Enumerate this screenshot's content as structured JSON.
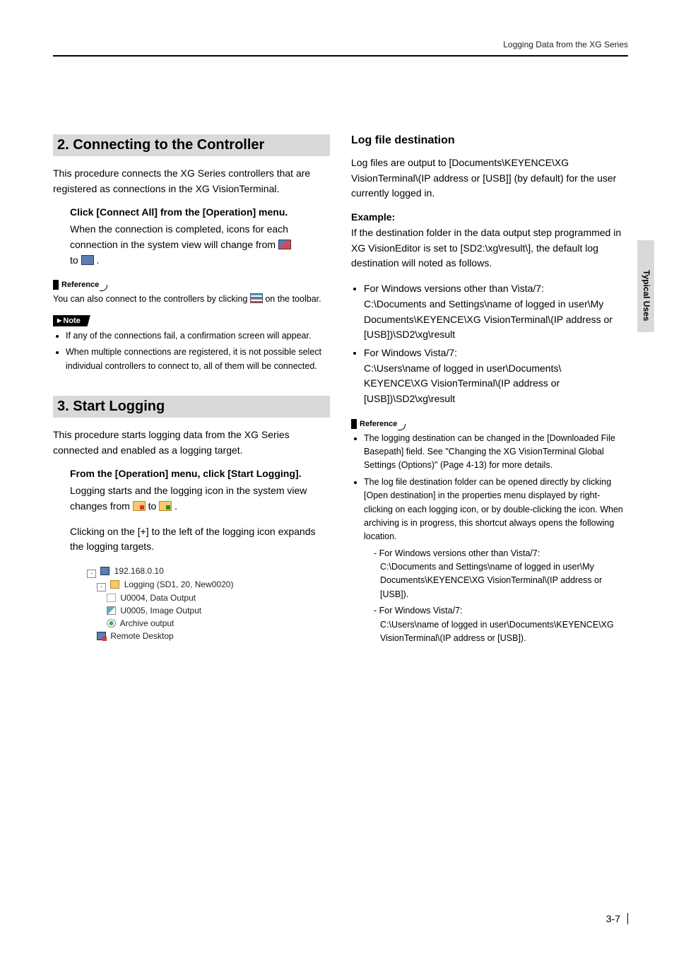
{
  "header": {
    "running": "Logging Data from the XG Series"
  },
  "side": {
    "label": "Typical Uses"
  },
  "page_number": "3-7",
  "sec2": {
    "title": "2. Connecting to the Controller",
    "intro": "This procedure connects the XG Series controllers that are registered as connections in the XG VisionTerminal.",
    "step_bold": "Click [Connect All] from the [Operation] menu.",
    "step_after1": "When the connection is completed, icons for each connection in the system view will change from ",
    "step_after2": "to ",
    "step_after3": " .",
    "ref_label": "Reference",
    "ref_text1": "You can also connect to the controllers by clicking ",
    "ref_text2": " on the toolbar.",
    "note_label": "Note",
    "note_items": [
      "If any of the connections fail, a confirmation screen will appear.",
      "When multiple connections are registered, it is not possible select individual controllers to connect to, all of them will be connected."
    ]
  },
  "sec3": {
    "title": "3. Start Logging",
    "intro": "This procedure starts logging data from the XG Series connected and enabled as a logging target.",
    "step_bold": "From the [Operation] menu, click [Start Logging].",
    "step_after1": "Logging starts and the logging icon in the system view changes from ",
    "step_mid": " to ",
    "step_after2": " .",
    "step_after3": "Clicking on the [+] to the left of the logging icon expands the logging targets.",
    "tree": {
      "root": "192.168.0.10",
      "logging": "Logging (SD1, 20, New0020)",
      "children": [
        "U0004, Data Output",
        "U0005, Image Output",
        "Archive output"
      ],
      "remote": "Remote Desktop"
    }
  },
  "right": {
    "subhead": "Log file destination",
    "intro": "Log files are output to [Documents\\KEYENCE\\XG VisionTerminal\\(IP address or [USB]] (by default) for the user currently logged in.",
    "example_label": "Example:",
    "example_intro": "If the destination folder in the data output step programmed in XG VisionEditor is set to [SD2:\\xg\\result\\], the default log destination will noted as follows.",
    "paths": [
      {
        "label": "For Windows versions other than Vista/7:",
        "path": "C:\\Documents and Settings\\name of logged in user\\My Documents\\KEYENCE\\XG VisionTerminal\\(IP address or [USB])\\SD2\\xg\\result"
      },
      {
        "label": "For Windows Vista/7:",
        "path": "C:\\Users\\name of logged in user\\Documents\\ KEYENCE\\XG VisionTerminal\\(IP address or [USB])\\SD2\\xg\\result"
      }
    ],
    "ref_label": "Reference",
    "ref_items": [
      "The logging destination can be changed in the [Downloaded File Basepath] field. See \"Changing the XG VisionTerminal Global Settings (Options)\" (Page 4-13) for more details.",
      "The log file destination folder can be opened directly by clicking [Open destination] in the properties menu displayed by right-clicking on each logging icon, or by double-clicking the icon. When archiving is in progress, this shortcut always opens the following location."
    ],
    "ref_sub": [
      {
        "label": "For Windows versions other than Vista/7:",
        "path": "C:\\Documents and Settings\\name of logged in user\\My Documents\\KEYENCE\\XG VisionTerminal\\(IP address or [USB])."
      },
      {
        "label": "For Windows Vista/7:",
        "path": "C:\\Users\\name of logged in user\\Documents\\KEYENCE\\XG VisionTerminal\\(IP address or [USB])."
      }
    ]
  }
}
